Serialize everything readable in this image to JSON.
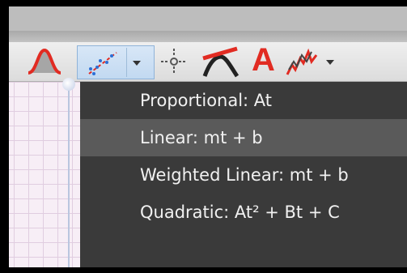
{
  "toolbar": {
    "tools": [
      {
        "name": "gaussian-peak-icon",
        "color": "#e12b22"
      },
      {
        "name": "curve-fit-icon",
        "color": "#2c6fd6",
        "selected": true
      },
      {
        "name": "dropdown-arrow-icon"
      },
      {
        "name": "examine-crosshair-icon"
      },
      {
        "name": "tangent-icon",
        "color": "#e12b22"
      },
      {
        "name": "text-annotation-icon",
        "label": "A",
        "color": "#e12b22"
      },
      {
        "name": "statistics-icon",
        "color": "#e12b22"
      },
      {
        "name": "dropdown-arrow-icon"
      }
    ]
  },
  "menu": {
    "items": [
      {
        "label": "Proportional: At",
        "highlighted": false
      },
      {
        "label": "Linear: mt + b",
        "highlighted": true
      },
      {
        "label": "Weighted Linear: mt + b",
        "highlighted": false
      },
      {
        "label": "Quadratic: At² + Bt + C",
        "highlighted": false
      }
    ]
  },
  "colors": {
    "menu_bg": "#3a3a3a",
    "menu_highlight": "#5a5a5a",
    "accent_red": "#e12b22",
    "accent_blue": "#2c6fd6"
  }
}
